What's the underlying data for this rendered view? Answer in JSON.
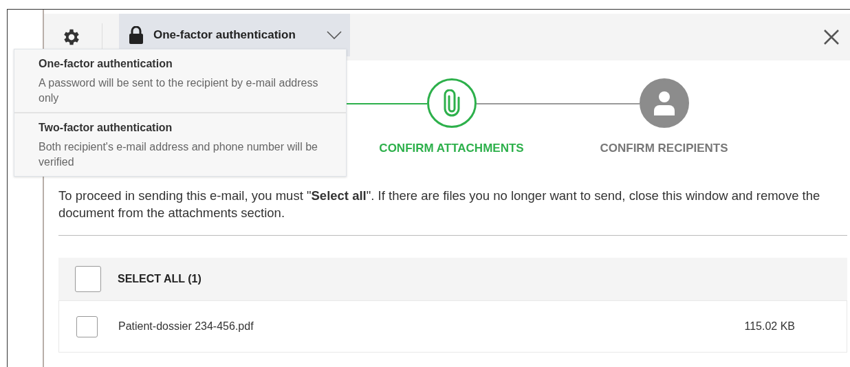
{
  "header": {
    "auth_select": {
      "label": "One-factor authentication",
      "expanded": true
    }
  },
  "auth_menu": [
    {
      "title": "One-factor authentication",
      "description": "A password will be sent to the recipient by e-mail address only"
    },
    {
      "title": "Two-factor authentication",
      "description": "Both recipient's e-mail address and phone number will be verified"
    }
  ],
  "stepper": [
    {
      "label": "CONFIRM ATTACHMENTS",
      "active": true,
      "kind": "attachment"
    },
    {
      "label": "CONFIRM RECIPIENTS",
      "active": false,
      "kind": "recipient"
    }
  ],
  "instruction": "To proceed in sending this e-mail, you must \"**Select all**\". If there are files you no longer want to send, close this window and remove the document from the attachments section.",
  "select_all": {
    "label": "SELECT ALL (1)",
    "checked": false
  },
  "files": [
    {
      "name": "Patient-dossier 234-456.pdf",
      "size": "115.02 KB",
      "checked": false
    }
  ]
}
